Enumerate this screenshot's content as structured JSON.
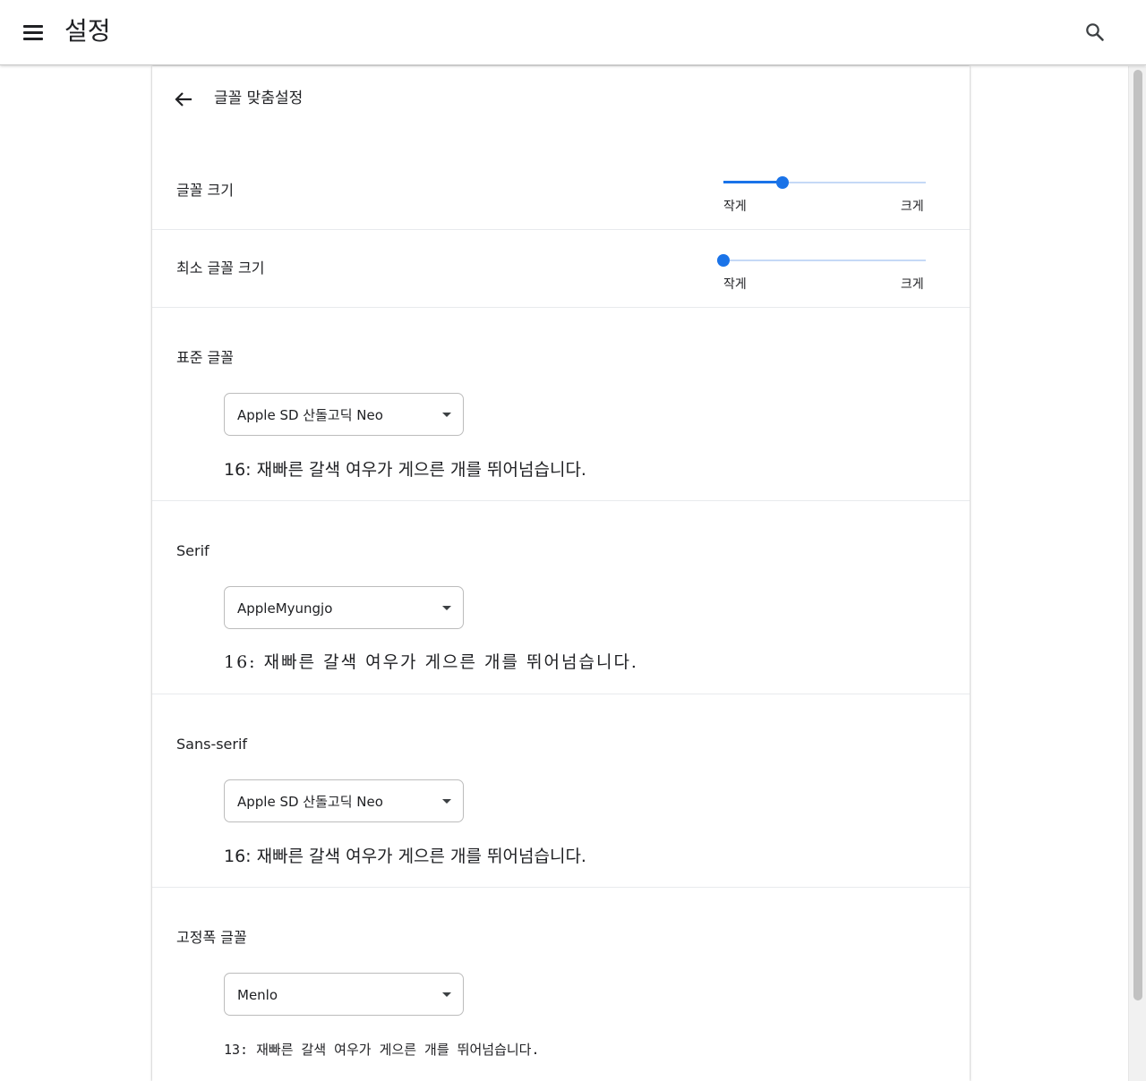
{
  "toolbar": {
    "title": "설정"
  },
  "subpage": {
    "title": "글꼴 맞춤설정"
  },
  "font_size": {
    "label": "글꼴 크기",
    "value_fraction": 0.29,
    "min_label": "작게",
    "max_label": "크게"
  },
  "minimum_font_size": {
    "label": "최소 글꼴 크기",
    "value_fraction": 0.0,
    "min_label": "작게",
    "max_label": "크게"
  },
  "standard_font": {
    "label": "표준 글꼴",
    "selected": "Apple SD 산돌고딕 Neo",
    "sample": "16: 재빠른 갈색 여우가 게으른 개를 뛰어넘습니다."
  },
  "serif_font": {
    "label": "Serif",
    "selected": "AppleMyungjo",
    "sample": "16: 재빠른 갈색 여우가 게으른 개를 뛰어넘습니다."
  },
  "sans_serif_font": {
    "label": "Sans-serif",
    "selected": "Apple SD 산돌고딕 Neo",
    "sample": "16: 재빠른 갈색 여우가 게으른 개를 뛰어넘습니다."
  },
  "fixed_width_font": {
    "label": "고정폭 글꼴",
    "selected": "Menlo",
    "sample": "13: 재빠른 갈색 여우가 게으른 개를 뛰어넘습니다."
  },
  "icons": {
    "menu": "menu-icon",
    "search": "search-icon",
    "back": "arrow-back-icon",
    "dropdown": "dropdown-arrow-icon"
  },
  "colors": {
    "accent": "#1a73e8",
    "track_inactive": "#c5d9f6",
    "divider": "#e8eaed"
  }
}
